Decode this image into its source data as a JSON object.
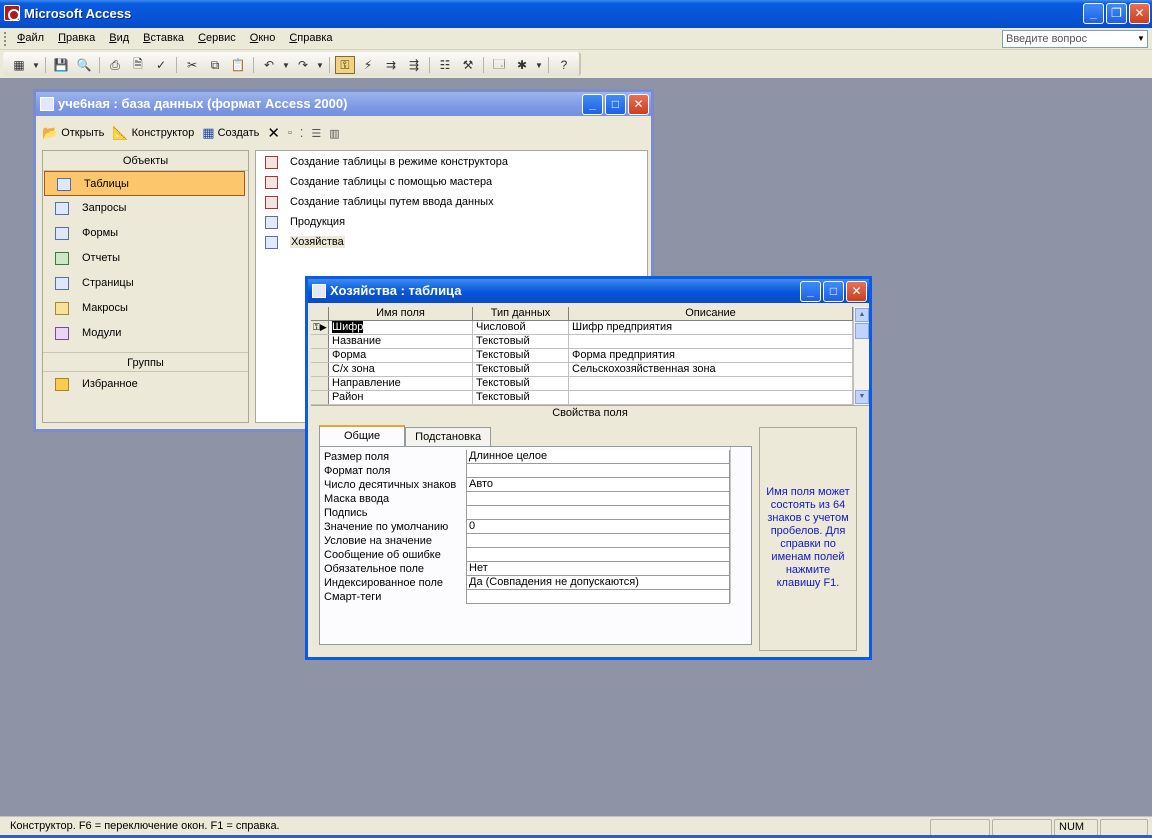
{
  "app": {
    "title": "Microsoft Access"
  },
  "menu": {
    "items": [
      "Файл",
      "Правка",
      "Вид",
      "Вставка",
      "Сервис",
      "Окно",
      "Справка"
    ],
    "help_placeholder": "Введите вопрос"
  },
  "db_window": {
    "title": "уче6ная : база данных (формат Access 2000)",
    "toolbar": {
      "open": "Открыть",
      "designer": "Конструктор",
      "create": "Создать"
    },
    "objects_header": "Объекты",
    "objects": [
      "Таблицы",
      "Запросы",
      "Формы",
      "Отчеты",
      "Страницы",
      "Макросы",
      "Модули"
    ],
    "selected_object": "Таблицы",
    "groups_header": "Группы",
    "groups": [
      "Избранное"
    ],
    "list": [
      {
        "label": "Создание таблицы в режиме конструктора",
        "icon": "wizard-icon"
      },
      {
        "label": "Создание таблицы с помощью мастера",
        "icon": "wizard-icon"
      },
      {
        "label": "Создание таблицы путем ввода данных",
        "icon": "wizard-icon"
      },
      {
        "label": "Продукция",
        "icon": "table-icon"
      },
      {
        "label": "Хозяйства",
        "icon": "table-icon"
      }
    ]
  },
  "table_window": {
    "title": "Хозяйства : таблица",
    "columns": [
      "Имя поля",
      "Тип данных",
      "Описание"
    ],
    "rows": [
      {
        "name": "Шифр",
        "type": "Числовой",
        "desc": "Шифр предприятия"
      },
      {
        "name": "Название",
        "type": "Текстовый",
        "desc": ""
      },
      {
        "name": "Форма",
        "type": "Текстовый",
        "desc": "Форма предприятия"
      },
      {
        "name": "С/х зона",
        "type": "Текстовый",
        "desc": "Сельскохозяйственная зона"
      },
      {
        "name": "Направление",
        "type": "Текстовый",
        "desc": ""
      },
      {
        "name": "Район",
        "type": "Текстовый",
        "desc": ""
      }
    ],
    "properties_title": "Свойства поля",
    "tabs": [
      "Общие",
      "Подстановка"
    ],
    "properties": [
      {
        "label": "Размер поля",
        "value": "Длинное целое"
      },
      {
        "label": "Формат поля",
        "value": ""
      },
      {
        "label": "Число десятичных знаков",
        "value": "Авто"
      },
      {
        "label": "Маска ввода",
        "value": ""
      },
      {
        "label": "Подпись",
        "value": ""
      },
      {
        "label": "Значение по умолчанию",
        "value": "0"
      },
      {
        "label": "Условие на значение",
        "value": ""
      },
      {
        "label": "Сообщение об ошибке",
        "value": ""
      },
      {
        "label": "Обязательное поле",
        "value": "Нет"
      },
      {
        "label": "Индексированное поле",
        "value": "Да (Совпадения не допускаются)"
      },
      {
        "label": "Смарт-теги",
        "value": ""
      }
    ],
    "help_text": "Имя поля может состоять из 64 знаков с учетом пробелов. Для справки по именам полей нажмите клавишу F1."
  },
  "status": {
    "text": "Конструктор.  F6 = переключение окон.  F1 = справка.",
    "num": "NUM"
  },
  "colors": {
    "title_blue": "#0754d8",
    "workspace": "#8e93a6",
    "selection_orange": "#fcc76c",
    "help_text": "#1016c5"
  }
}
